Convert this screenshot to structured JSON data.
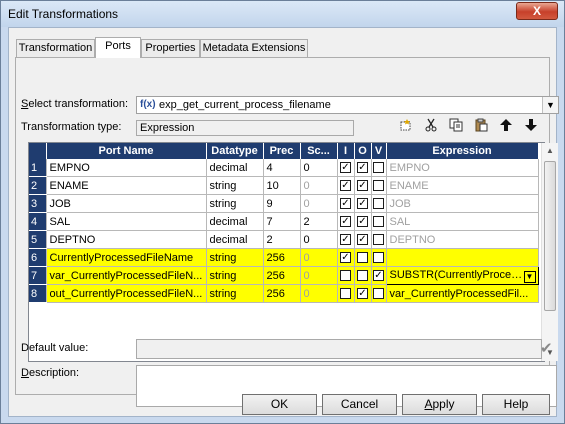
{
  "window": {
    "title": "Edit Transformations",
    "close_label": "X"
  },
  "tabs": [
    {
      "label": "Transformation",
      "active": false
    },
    {
      "label": "Ports",
      "active": true
    },
    {
      "label": "Properties",
      "active": false
    },
    {
      "label": "Metadata Extensions",
      "active": false
    }
  ],
  "select_transformation": {
    "label_first": "S",
    "label_rest": "elect transformation:",
    "value": "exp_get_current_process_filename"
  },
  "transformation_type": {
    "label": "Transformation type:",
    "value": "Expression"
  },
  "toolbar": [
    "new-port-icon",
    "cut-icon",
    "copy-icon",
    "paste-icon",
    "move-up-icon",
    "move-down-icon"
  ],
  "grid": {
    "columns": [
      "Port Name",
      "Datatype",
      "Prec",
      "Sc...",
      "I",
      "O",
      "V",
      "Expression"
    ],
    "rows": [
      {
        "num": "1",
        "name": "EMPNO",
        "type": "decimal",
        "prec": "4",
        "scale": "0",
        "i": true,
        "o": true,
        "v": false,
        "expr": "EMPNO",
        "highlight": false,
        "scale_grey": false
      },
      {
        "num": "2",
        "name": "ENAME",
        "type": "string",
        "prec": "10",
        "scale": "0",
        "i": true,
        "o": true,
        "v": false,
        "expr": "ENAME",
        "highlight": false,
        "scale_grey": true
      },
      {
        "num": "3",
        "name": "JOB",
        "type": "string",
        "prec": "9",
        "scale": "0",
        "i": true,
        "o": true,
        "v": false,
        "expr": "JOB",
        "highlight": false,
        "scale_grey": true
      },
      {
        "num": "4",
        "name": "SAL",
        "type": "decimal",
        "prec": "7",
        "scale": "2",
        "i": true,
        "o": true,
        "v": false,
        "expr": "SAL",
        "highlight": false,
        "scale_grey": false
      },
      {
        "num": "5",
        "name": "DEPTNO",
        "type": "decimal",
        "prec": "2",
        "scale": "0",
        "i": true,
        "o": true,
        "v": false,
        "expr": "DEPTNO",
        "highlight": false,
        "scale_grey": false
      },
      {
        "num": "6",
        "name": "CurrentlyProcessedFileName",
        "type": "string",
        "prec": "256",
        "scale": "0",
        "i": true,
        "o": false,
        "v": false,
        "expr": "",
        "highlight": true,
        "scale_grey": true
      },
      {
        "num": "7",
        "name": "var_CurrentlyProcessedFileN...",
        "type": "string",
        "prec": "256",
        "scale": "0",
        "i": false,
        "o": false,
        "v": true,
        "expr": "SUBSTR(CurrentlyProces...",
        "highlight": true,
        "scale_grey": true
      },
      {
        "num": "8",
        "name": "out_CurrentlyProcessedFileN...",
        "type": "string",
        "prec": "256",
        "scale": "0",
        "i": false,
        "o": true,
        "v": false,
        "expr": "var_CurrentlyProcessedFil...",
        "highlight": true,
        "scale_grey": true
      }
    ]
  },
  "default_value": {
    "label": "Default value:",
    "value": ""
  },
  "description": {
    "label_first": "D",
    "label_rest": "escription:",
    "value": ""
  },
  "buttons": {
    "ok": "OK",
    "cancel": "Cancel",
    "apply_first": "A",
    "apply_rest": "pply",
    "help": "Help"
  },
  "colors": {
    "grid_header": "#1f3c6f",
    "highlight": "#ffff00"
  }
}
